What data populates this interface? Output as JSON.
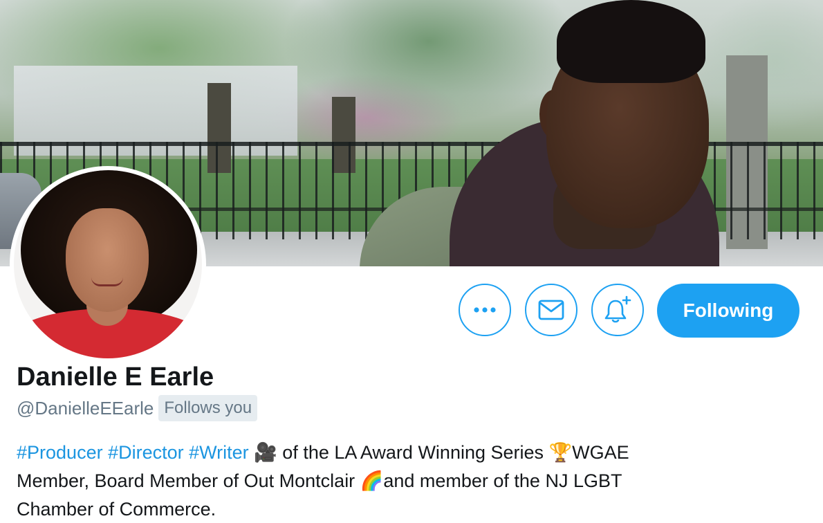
{
  "banner": {
    "description_icon": "header-photo"
  },
  "profile": {
    "display_name": "Danielle E Earle",
    "handle": "@DanielleEEarle",
    "follows_badge": "Follows you",
    "bio": {
      "hashtags": [
        "#Producer",
        "#Director",
        "#Writer"
      ],
      "camera_emoji": "🎥",
      "text_1": " of the LA Award Winning Series ",
      "trophy_emoji": "🏆",
      "text_2": "WGAE",
      "line_2_a": "Member, Board Member of Out Montclair ",
      "rainbow_emoji": "🌈",
      "line_2_b": "and member of the NJ LGBT",
      "line_3": "Chamber of Commerce."
    }
  },
  "actions": {
    "more_icon": "more-dots-icon",
    "message_icon": "envelope-icon",
    "notify_icon": "bell-plus-icon",
    "following_label": "Following"
  },
  "colors": {
    "accent": "#1da1f2",
    "hashtag": "#1b95e0",
    "secondary_text": "#657786",
    "badge_bg": "#e6ecf0"
  }
}
